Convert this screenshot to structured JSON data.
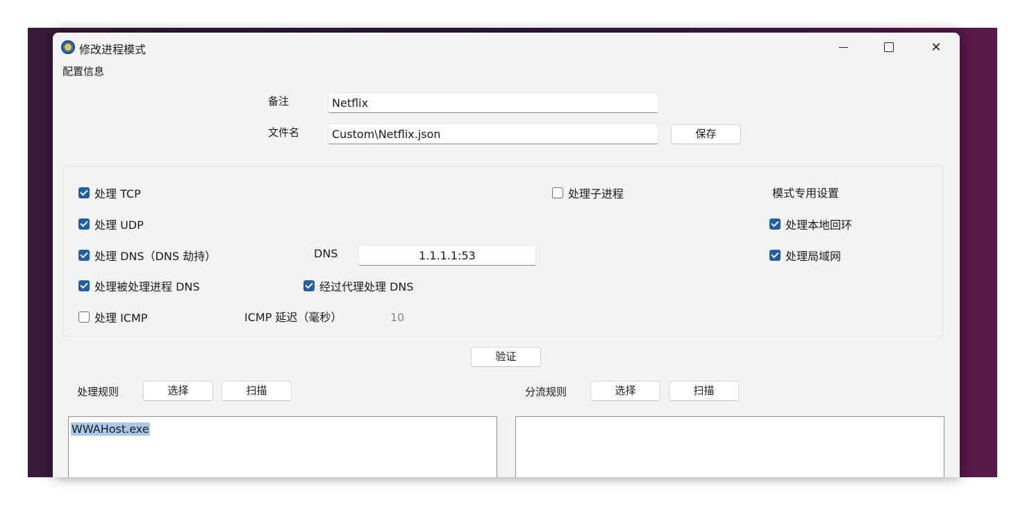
{
  "window": {
    "title": "修改进程模式"
  },
  "menu": {
    "config": "配置信息"
  },
  "form": {
    "remark_label": "备注",
    "remark_value": "Netflix",
    "filename_label": "文件名",
    "filename_value": "Custom\\Netflix.json",
    "save_button": "保存"
  },
  "options": {
    "tcp": {
      "label": "处理 TCP",
      "checked": true
    },
    "udp": {
      "label": "处理 UDP",
      "checked": true
    },
    "dns": {
      "label": "处理 DNS（DNS 劫持）",
      "checked": true
    },
    "proc_dns": {
      "label": "处理被处理进程 DNS",
      "checked": true
    },
    "icmp": {
      "label": "处理 ICMP",
      "checked": false
    },
    "child": {
      "label": "处理子进程",
      "checked": false
    },
    "proxy_dns": {
      "label": "经过代理处理 DNS",
      "checked": true
    },
    "dns_label": "DNS",
    "dns_value": "1.1.1.1:53",
    "icmp_delay_label": "ICMP 延迟（毫秒）",
    "icmp_delay_value": "10",
    "mode_section": "模式专用设置",
    "loopback": {
      "label": "处理本地回环",
      "checked": true
    },
    "lan": {
      "label": "处理局域网",
      "checked": true
    }
  },
  "validate_button": "验证",
  "rules": {
    "process_label": "处理规则",
    "select_button": "选择",
    "scan_button": "扫描",
    "items": [
      "WWAHost.exe"
    ]
  },
  "split": {
    "label": "分流规则",
    "select_button": "选择",
    "scan_button": "扫描"
  }
}
